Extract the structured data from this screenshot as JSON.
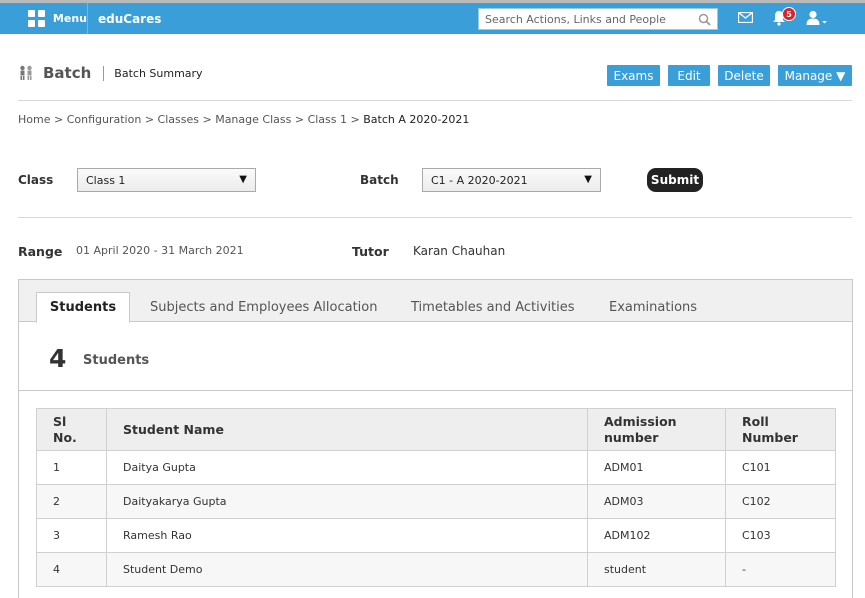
{
  "topbar": {
    "menu_label": "Menu",
    "brand": "eduCares",
    "search_placeholder": "Search Actions, Links and People",
    "notification_count": "5"
  },
  "header": {
    "title": "Batch",
    "subtitle": "Batch Summary",
    "buttons": {
      "exams": "Exams",
      "edit": "Edit",
      "delete": "Delete",
      "manage": "Manage ▼"
    }
  },
  "breadcrumb": {
    "items": [
      "Home",
      "Configuration",
      "Classes",
      "Manage Class",
      "Class 1"
    ],
    "current": "Batch A 2020-2021",
    "separator": ">"
  },
  "filters": {
    "class_label": "Class",
    "class_value": "Class 1",
    "batch_label": "Batch",
    "batch_value": "C1 - A 2020-2021",
    "submit_label": "Submit"
  },
  "info": {
    "range_label": "Range",
    "range_value": "01 April 2020 - 31 March 2021",
    "tutor_label": "Tutor",
    "tutor_value": "Karan Chauhan"
  },
  "tabs": [
    {
      "label": "Students",
      "active": true
    },
    {
      "label": "Subjects and Employees Allocation",
      "active": false
    },
    {
      "label": "Timetables and Activities",
      "active": false
    },
    {
      "label": "Examinations",
      "active": false
    }
  ],
  "students": {
    "count": "4",
    "count_label": "Students",
    "columns": [
      "Sl No.",
      "Student Name",
      "Admission number",
      "Roll Number"
    ],
    "rows": [
      {
        "sl": "1",
        "name": "Daitya Gupta",
        "admission": "ADM01",
        "roll": "C101"
      },
      {
        "sl": "2",
        "name": "Daityakarya Gupta",
        "admission": "ADM03",
        "roll": "C102"
      },
      {
        "sl": "3",
        "name": "Ramesh Rao",
        "admission": "ADM102",
        "roll": "C103"
      },
      {
        "sl": "4",
        "name": "Student Demo",
        "admission": "student",
        "roll": "-"
      }
    ]
  },
  "colors": {
    "accent": "#3a9fd9",
    "badge": "#d8242d",
    "submit": "#222222"
  }
}
